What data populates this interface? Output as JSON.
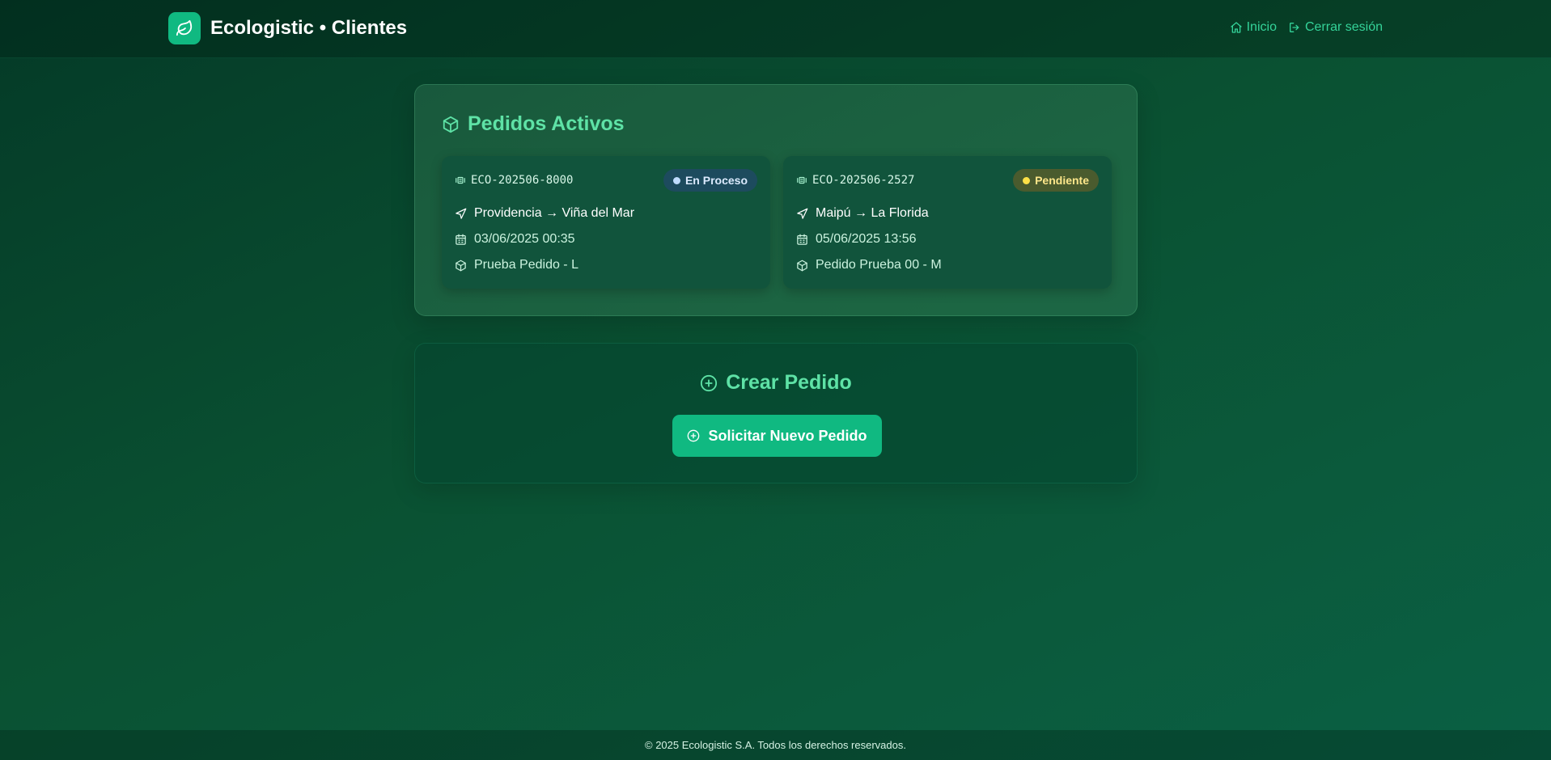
{
  "header": {
    "brand_title": "Ecologistic • Clientes",
    "nav": {
      "home_label": "Inicio",
      "logout_label": "Cerrar sesión"
    }
  },
  "active_orders": {
    "title": "Pedidos Activos",
    "orders": [
      {
        "id": "ECO-202506-8000",
        "status": "En Proceso",
        "route": "Providencia → Viña del Mar",
        "date": "03/06/2025 00:35",
        "description": "Prueba Pedido - L"
      },
      {
        "id": "ECO-202506-2527",
        "status": "Pendiente",
        "route": "Maipú → La Florida",
        "date": "05/06/2025 13:56",
        "description": "Pedido Prueba 00 - M"
      }
    ]
  },
  "create_order": {
    "title": "Crear Pedido",
    "button_label": "Solicitar Nuevo Pedido"
  },
  "footer": {
    "text": "© 2025 Ecologistic S.A. Todos los derechos reservados."
  },
  "colors": {
    "accent": "#10b981",
    "accent_text": "#34d399",
    "status_in_process_bg": "#1d4b5e",
    "status_pending_bg": "#4a5b2e"
  }
}
